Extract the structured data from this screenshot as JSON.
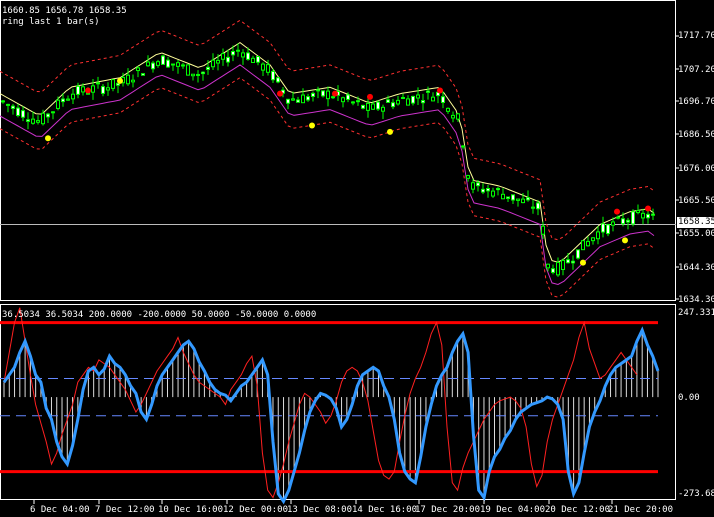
{
  "colors": {
    "background": "#000000",
    "axis": "#ffffff",
    "bull_candle": "#00ff00",
    "bear_candle": "#00ff00",
    "bollinger_outer": "#ff3030",
    "bollinger_mid": "#ffff99",
    "envelope_lower": "#cc33cc",
    "dot_up": "#ff0000",
    "dot_down": "#ffff00",
    "cci_line": "#3399ff",
    "cci_signal": "#ff2020",
    "cci_levels": "#ff0000",
    "cci_dash": "#6688ff"
  },
  "main_panel": {
    "info_line": "1660.85 1656.78 1658.35",
    "info_line2": "ring last 1 bar(s)",
    "price_labels": [
      "1717.70",
      "1707.20",
      "1696.70",
      "1686.50",
      "1676.00",
      "1665.50",
      "1655.00",
      "1644.30",
      "1634.30"
    ],
    "current_price": "1658.35"
  },
  "sub_panel": {
    "info_line": "36.5034 36.5034 200.0000 -200.0000 50.0000 -50.0000 0.0000",
    "labels": [
      "247.3314",
      "0.00",
      "-273.682"
    ]
  },
  "time_labels": [
    "6 Dec 04:00",
    "7 Dec 12:00",
    "10 Dec 16:00",
    "12 Dec 00:00",
    "13 Dec 08:00",
    "14 Dec 16:00",
    "17 Dec 20:00",
    "19 Dec 04:00",
    "20 Dec 12:00",
    "21 Dec 20:00"
  ],
  "chart_data": {
    "type": "candlestick",
    "price_range": [
      1634.3,
      1717.7
    ],
    "cci_range": [
      -273.682,
      247.3314
    ],
    "cci_levels": [
      200,
      -200,
      50,
      -50,
      0
    ],
    "cci": [
      40,
      60,
      80,
      120,
      150,
      110,
      60,
      40,
      -30,
      -60,
      -120,
      -160,
      -180,
      -130,
      -60,
      20,
      70,
      80,
      60,
      75,
      110,
      90,
      80,
      60,
      30,
      10,
      -40,
      -60,
      -20,
      30,
      60,
      80,
      100,
      120,
      140,
      150,
      130,
      95,
      70,
      40,
      20,
      10,
      5,
      -10,
      10,
      30,
      40,
      60,
      80,
      100,
      60,
      -120,
      -260,
      -280,
      -250,
      -200,
      -150,
      -90,
      -40,
      -10,
      10,
      5,
      -5,
      -30,
      -80,
      -60,
      -20,
      30,
      60,
      70,
      80,
      70,
      30,
      0,
      -60,
      -150,
      -200,
      -220,
      -230,
      -160,
      -80,
      -20,
      30,
      60,
      80,
      120,
      150,
      170,
      120,
      -100,
      -250,
      -270,
      -200,
      -160,
      -140,
      -110,
      -90,
      -60,
      -40,
      -30,
      -20,
      -15,
      -10,
      0,
      -5,
      -20,
      -60,
      -200,
      -260,
      -230,
      -150,
      -80,
      -40,
      -10,
      30,
      60,
      80,
      90,
      100,
      110,
      150,
      180,
      140,
      110,
      70
    ],
    "cci_signal": [
      40,
      120,
      200,
      240,
      150,
      60,
      -20,
      -70,
      -120,
      -180,
      -150,
      -100,
      -60,
      -20,
      40,
      60,
      80,
      70,
      100,
      90,
      80,
      60,
      40,
      20,
      -10,
      -40,
      -20,
      10,
      40,
      70,
      90,
      110,
      130,
      160,
      120,
      90,
      60,
      40,
      30,
      20,
      10,
      0,
      -20,
      20,
      40,
      60,
      90,
      110,
      30,
      -150,
      -250,
      -270,
      -230,
      -180,
      -120,
      -70,
      -20,
      10,
      0,
      -20,
      -40,
      -70,
      -50,
      -10,
      40,
      70,
      80,
      70,
      40,
      -10,
      -90,
      -170,
      -210,
      -220,
      -200,
      -120,
      -50,
      10,
      50,
      80,
      120,
      170,
      200,
      140,
      -80,
      -230,
      -250,
      -190,
      -150,
      -120,
      -90,
      -60,
      -40,
      -20,
      -10,
      -5,
      0,
      -10,
      -30,
      -80,
      -180,
      -240,
      -210,
      -120,
      -60,
      -20,
      20,
      60,
      100,
      160,
      200,
      130,
      90,
      50,
      60,
      80,
      100,
      120,
      100,
      80,
      60
    ]
  }
}
